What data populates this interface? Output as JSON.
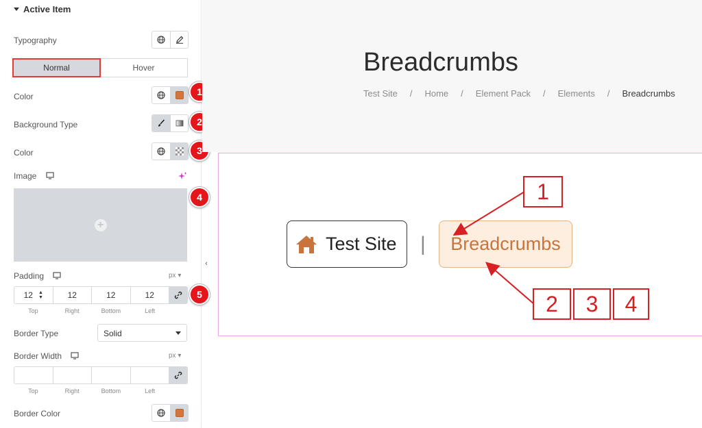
{
  "panel": {
    "section_title": "Active Item",
    "typography_label": "Typography",
    "tabs": [
      "Normal",
      "Hover"
    ],
    "color_label": "Color",
    "color_swatch": "#d2763b",
    "background_type_label": "Background Type",
    "bg_color_label": "Color",
    "image_label": "Image",
    "padding_label": "Padding",
    "padding_unit": "px",
    "padding_values": [
      "12",
      "12",
      "12",
      "12"
    ],
    "dimension_labels": [
      "Top",
      "Right",
      "Bottom",
      "Left"
    ],
    "border_type_label": "Border Type",
    "border_type_value": "Solid",
    "border_width_label": "Border Width",
    "border_width_unit": "px",
    "border_color_label": "Border Color",
    "border_color_swatch": "#d2763b"
  },
  "badges": [
    "1",
    "2",
    "3",
    "4",
    "5"
  ],
  "preview": {
    "heading": "Breadcrumbs",
    "trail": [
      "Test Site",
      "Home",
      "Element Pack",
      "Elements",
      "Breadcrumbs"
    ],
    "trail_separator": "/",
    "demo_home_label": "Test Site",
    "demo_divider": "|",
    "demo_active_label": "Breadcrumbs",
    "callouts": [
      "1",
      "2",
      "3",
      "4"
    ]
  },
  "colors": {
    "badge_red": "#e4161b",
    "accent_orange": "#c8743d",
    "active_bg": "#fdeedf"
  }
}
